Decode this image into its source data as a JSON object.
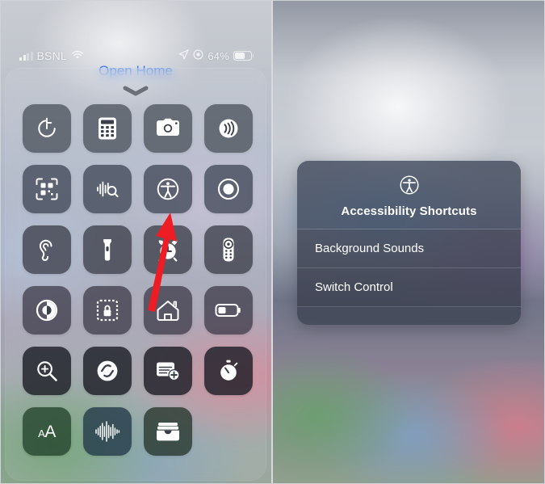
{
  "status_bar": {
    "signal_icon": "cellular-bars-icon",
    "carrier": "BSNL",
    "wifi_icon": "wifi-icon",
    "location_icon": "location-arrow-icon",
    "focus_icon": "focus-mode-icon",
    "battery_percent": "64%",
    "battery_icon": "battery-icon"
  },
  "left_panel": {
    "open_home_label": "Open Home",
    "grab_handle_icon": "chevron-down-icon",
    "controls": [
      {
        "name": "timer",
        "icon": "timer-icon",
        "label": "Timer"
      },
      {
        "name": "calculator",
        "icon": "calculator-icon",
        "label": "Calculator"
      },
      {
        "name": "camera",
        "icon": "camera-icon",
        "label": "Camera"
      },
      {
        "name": "nfc-tag-reader",
        "icon": "contactless-waves-icon",
        "label": "NFC Tag Reader"
      },
      {
        "name": "code-scanner",
        "icon": "qr-code-scanner-icon",
        "label": "Code Scanner"
      },
      {
        "name": "sound-recognition",
        "icon": "sound-recognition-icon",
        "label": "Sound Recognition"
      },
      {
        "name": "accessibility-shortcuts",
        "icon": "accessibility-icon",
        "label": "Accessibility Shortcuts"
      },
      {
        "name": "screen-recording",
        "icon": "screen-record-icon",
        "label": "Screen Recording"
      },
      {
        "name": "hearing",
        "icon": "ear-hearing-icon",
        "label": "Hearing"
      },
      {
        "name": "flashlight",
        "icon": "flashlight-icon",
        "label": "Flashlight"
      },
      {
        "name": "alarm",
        "icon": "alarm-clock-icon",
        "label": "Alarm"
      },
      {
        "name": "apple-tv-remote",
        "icon": "tv-remote-icon",
        "label": "Apple TV Remote"
      },
      {
        "name": "dark-mode",
        "icon": "contrast-circle-icon",
        "label": "Dark Mode"
      },
      {
        "name": "guided-access",
        "icon": "lock-dashed-icon",
        "label": "Guided Access"
      },
      {
        "name": "home",
        "icon": "home-icon",
        "label": "Home"
      },
      {
        "name": "low-power-mode",
        "icon": "battery-half-icon",
        "label": "Low Power Mode"
      },
      {
        "name": "magnifier",
        "icon": "magnifier-plus-icon",
        "label": "Magnifier"
      },
      {
        "name": "music-recognition",
        "icon": "shazam-icon",
        "label": "Music Recognition"
      },
      {
        "name": "quick-note",
        "icon": "note-plus-icon",
        "label": "Quick Note"
      },
      {
        "name": "stopwatch",
        "icon": "stopwatch-icon",
        "label": "Stopwatch"
      },
      {
        "name": "text-size",
        "icon": "text-size-icon",
        "label": "Text Size"
      },
      {
        "name": "voice-memos",
        "icon": "waveform-icon",
        "label": "Voice Memos"
      },
      {
        "name": "wallet",
        "icon": "wallet-icon",
        "label": "Wallet"
      }
    ]
  },
  "right_panel": {
    "dialog": {
      "icon": "accessibility-icon",
      "title": "Accessibility Shortcuts",
      "options": [
        {
          "label": "Background Sounds"
        },
        {
          "label": "Switch Control"
        }
      ]
    }
  },
  "annotation": {
    "arrow_icon": "red-arrow-up-icon",
    "arrow_color": "#ee1c24",
    "points_at": "accessibility-shortcuts"
  },
  "colors": {
    "accent_blue": "#3c7df0",
    "tile_bg": "#343842",
    "annotation_red": "#ee1c24",
    "text_white": "#ffffff"
  }
}
